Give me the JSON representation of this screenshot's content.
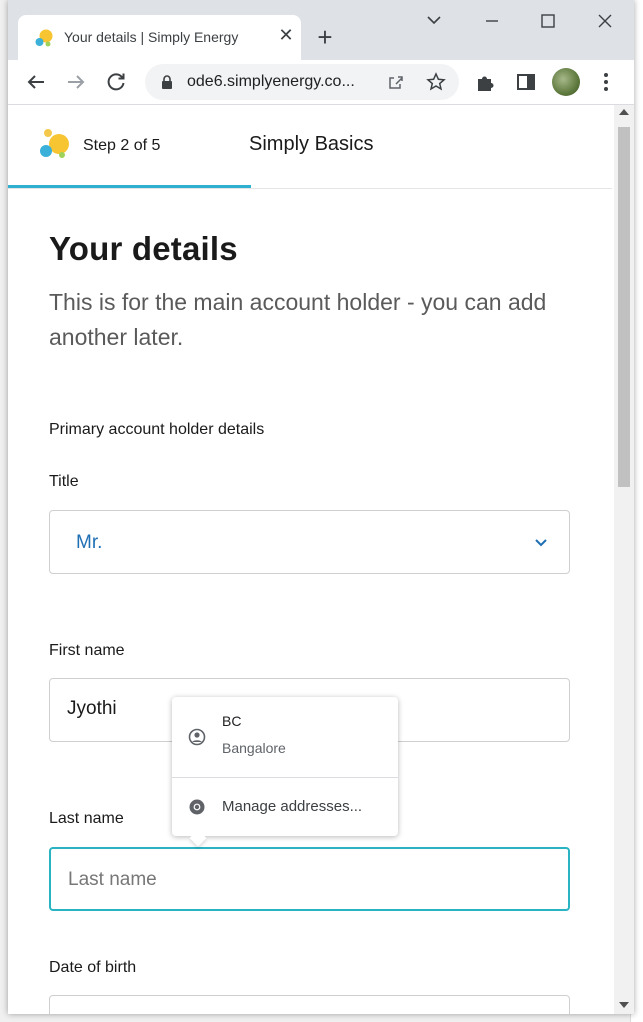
{
  "browser": {
    "tab_title": "Your details | Simply Energy",
    "url": "ode6.simplyenergy.co..."
  },
  "stepper": {
    "step_label": "Step 2 of 5",
    "plan_name": "Simply Basics"
  },
  "form": {
    "heading": "Your details",
    "subtitle": "This is for the main account holder - you can add another later.",
    "section_label": "Primary account holder details",
    "title_label": "Title",
    "title_value": "Mr.",
    "first_name_label": "First name",
    "first_name_value": "Jyothi",
    "last_name_label": "Last name",
    "last_name_placeholder": "Last name",
    "dob_label": "Date of birth"
  },
  "autofill": {
    "name": "BC",
    "city": "Bangalore",
    "manage": "Manage addresses..."
  },
  "colors": {
    "accent": "#30b0d0",
    "select_text": "#1f6fb5",
    "focus_border": "#2ab3c3"
  }
}
